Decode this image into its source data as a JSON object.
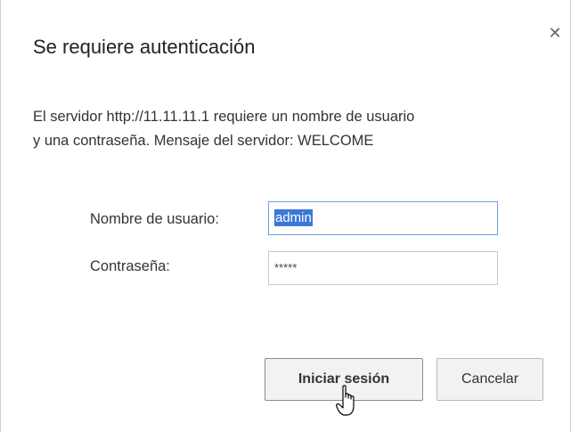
{
  "dialog": {
    "title": "Se requiere autenticación",
    "close_icon": "close-icon",
    "message_line1": "El servidor http://11.11.11.1 requiere un nombre de usuario",
    "message_line2": "y una contraseña. Mensaje del servidor: WELCOME",
    "username_label": "Nombre de usuario:",
    "username_value": "admin",
    "password_label": "Contraseña:",
    "password_value": "*****",
    "signin_label": "Iniciar sesión",
    "cancel_label": "Cancelar",
    "cursor_icon": "pointer-cursor-icon"
  },
  "colors": {
    "selection": "#3b79d8",
    "focus_border": "#6d9de6",
    "button_bg": "#f2f2f2"
  }
}
